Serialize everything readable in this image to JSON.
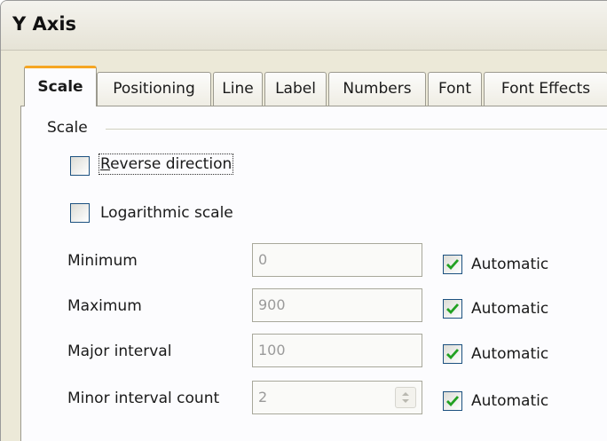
{
  "window": {
    "title": "Y Axis"
  },
  "tabs": [
    {
      "label": "Scale",
      "active": true
    },
    {
      "label": "Positioning",
      "active": false
    },
    {
      "label": "Line",
      "active": false
    },
    {
      "label": "Label",
      "active": false
    },
    {
      "label": "Numbers",
      "active": false
    },
    {
      "label": "Font",
      "active": false
    },
    {
      "label": "Font Effects",
      "active": false
    }
  ],
  "scale": {
    "group_label": "Scale",
    "reverse_direction": {
      "label": "Reverse direction",
      "checked": false
    },
    "logarithmic_scale": {
      "label": "Logarithmic scale",
      "checked": false
    },
    "fields": [
      {
        "label": "Minimum",
        "value": "0",
        "automatic_label": "Automatic",
        "automatic": true
      },
      {
        "label": "Maximum",
        "value": "900",
        "automatic_label": "Automatic",
        "automatic": true
      },
      {
        "label": "Major interval",
        "value": "100",
        "automatic_label": "Automatic",
        "automatic": true
      },
      {
        "label": "Minor interval count",
        "value": "2",
        "automatic_label": "Automatic",
        "automatic": true
      }
    ]
  },
  "colors": {
    "accent_tab": "#f5a623",
    "checkmark": "#21a121",
    "checkbox_border": "#1c5180"
  }
}
